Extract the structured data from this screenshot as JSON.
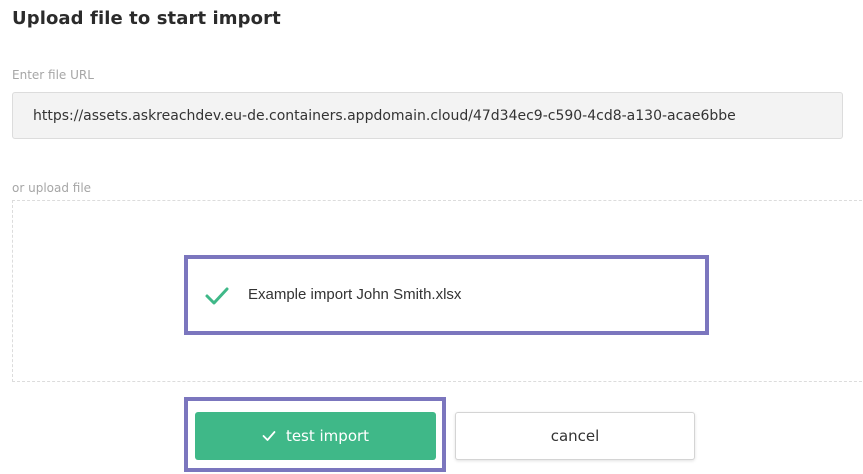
{
  "header": {
    "title": "Upload file to start import"
  },
  "url_field": {
    "label": "Enter file URL",
    "value": "https://assets.askreachdev.eu-de.containers.appdomain.cloud/47d34ec9-c590-4cd8-a130-acae6bbe"
  },
  "upload": {
    "label": "or upload file",
    "file": {
      "name": "Example import John Smith.xlsx",
      "status_icon": "check-icon"
    }
  },
  "actions": {
    "test_import_label": "test import",
    "test_import_icon": "check-icon",
    "cancel_label": "cancel"
  },
  "colors": {
    "accent_green": "#3fb888",
    "highlight_border": "#7b76be",
    "input_background": "#f3f3f3",
    "label_gray": "#a6a6a6"
  }
}
